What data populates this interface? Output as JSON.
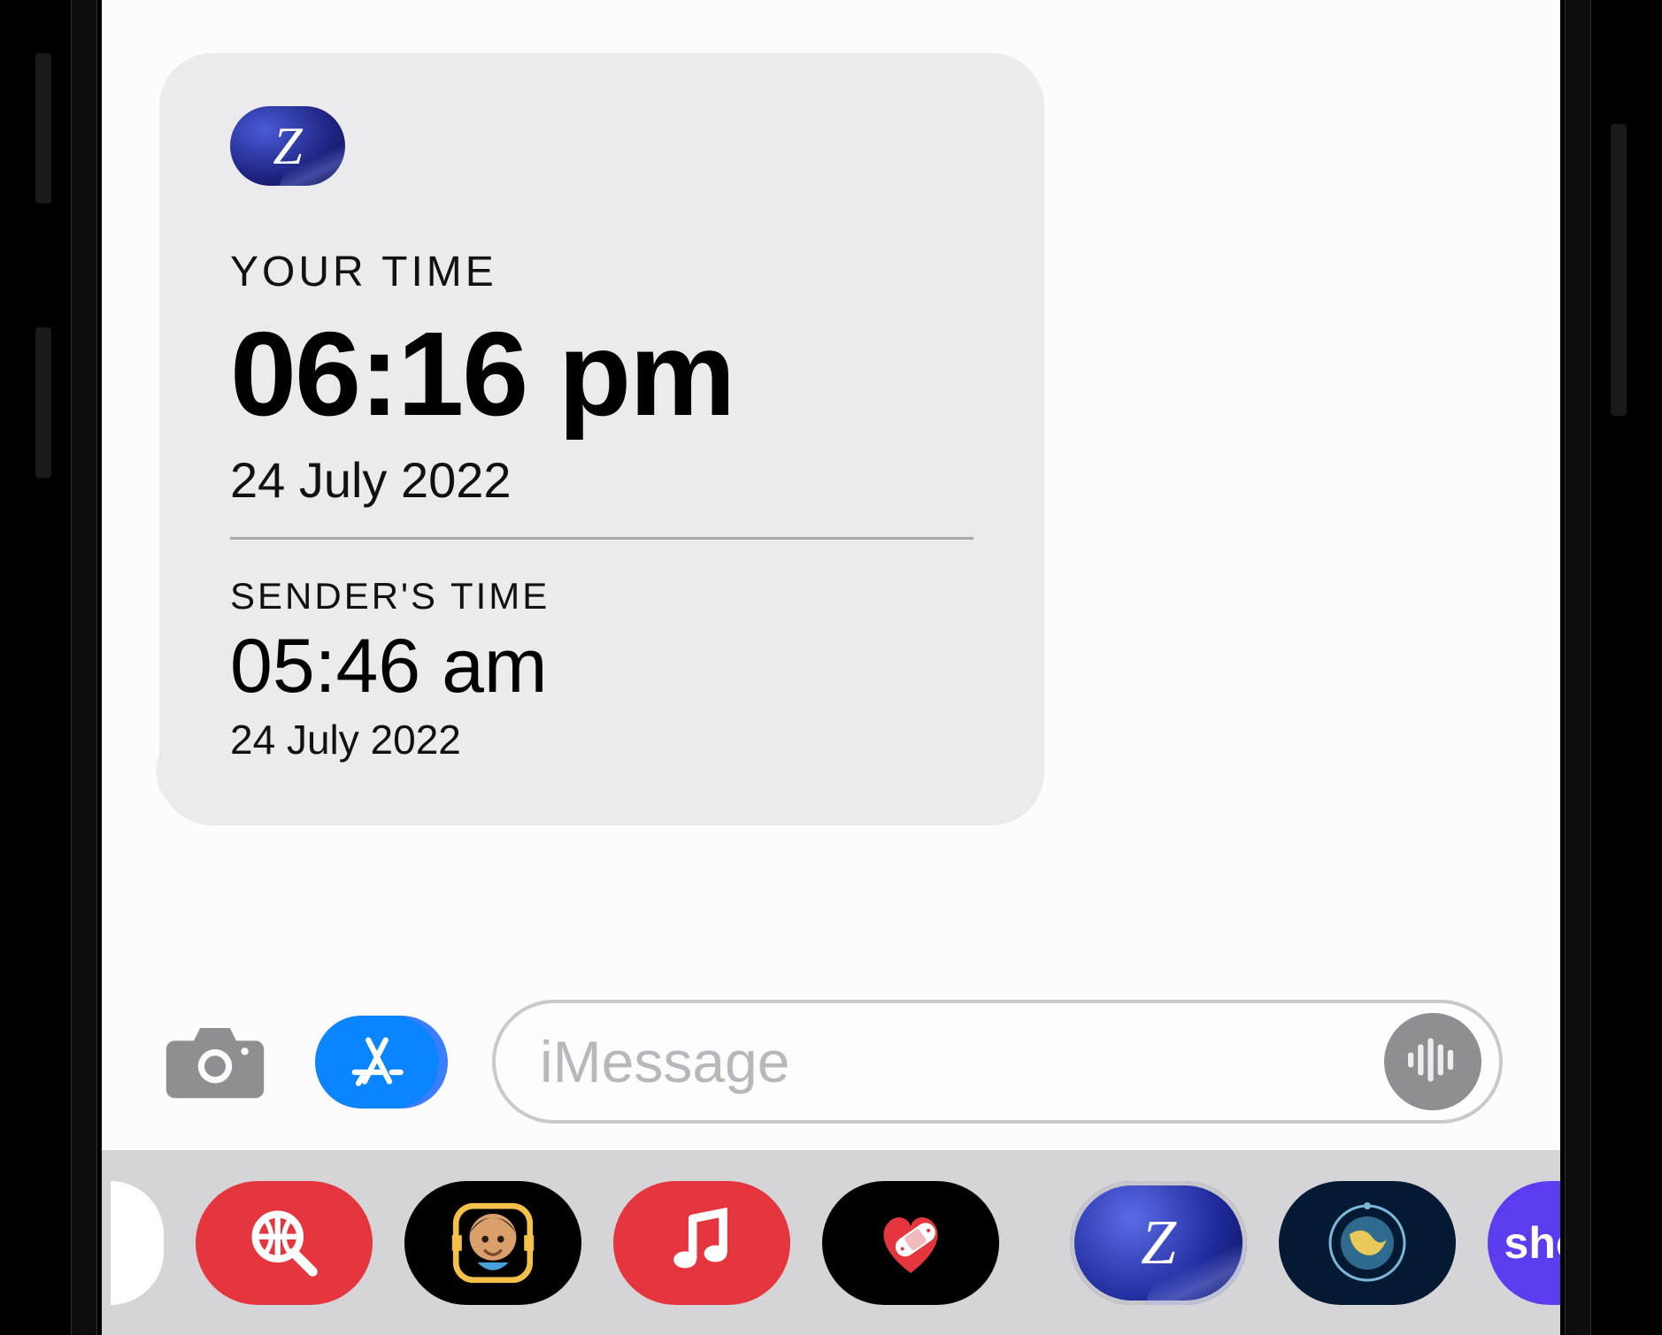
{
  "message": {
    "app_glyph": "Z",
    "your_time_label": "YOUR TIME",
    "your_time_value": "06:16 pm",
    "your_time_date": "24 July 2022",
    "sender_time_label": "SENDER'S TIME",
    "sender_time_value": "05:46 am",
    "sender_time_date": "24 July 2022"
  },
  "composer": {
    "placeholder": "iMessage"
  },
  "drawer": {
    "zones_glyph": "Z",
    "sho_label": "sho"
  }
}
